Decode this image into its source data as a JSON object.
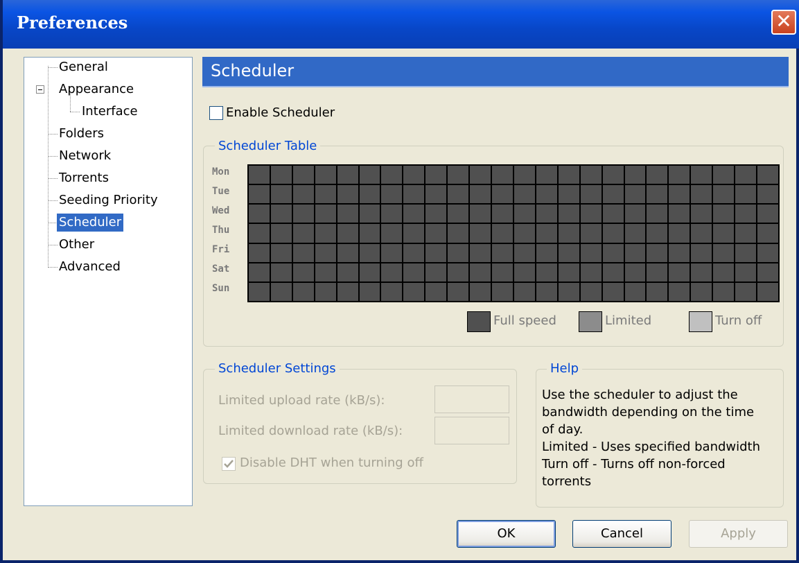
{
  "window": {
    "title": "Preferences",
    "close_glyph": "✕"
  },
  "tree": {
    "items": [
      {
        "label": "General"
      },
      {
        "label": "Appearance"
      },
      {
        "label": "Interface"
      },
      {
        "label": "Folders"
      },
      {
        "label": "Network"
      },
      {
        "label": "Torrents"
      },
      {
        "label": "Seeding Priority"
      },
      {
        "label": "Scheduler",
        "selected": true
      },
      {
        "label": "Other"
      },
      {
        "label": "Advanced"
      }
    ]
  },
  "page": {
    "title": "Scheduler"
  },
  "enable_scheduler": {
    "label": "Enable Scheduler",
    "checked": false
  },
  "scheduler_table": {
    "title": "Scheduler Table",
    "days": [
      "Mon",
      "Tue",
      "Wed",
      "Thu",
      "Fri",
      "Sat",
      "Sun"
    ],
    "hours_per_day": 24,
    "legend": [
      {
        "label": "Full speed",
        "color": "#505050"
      },
      {
        "label": "Limited",
        "color": "#8c8c8c"
      },
      {
        "label": "Turn off",
        "color": "#c0c0c0"
      }
    ]
  },
  "scheduler_settings": {
    "title": "Scheduler Settings",
    "upload_label": "Limited upload rate (kB/s):",
    "upload_value": "",
    "download_label": "Limited download rate (kB/s):",
    "download_value": "",
    "dht_label": "Disable DHT when turning off",
    "dht_checked": true
  },
  "help": {
    "title": "Help",
    "lines": [
      "Use the scheduler to adjust the",
      "bandwidth depending on the time",
      "of day.",
      "Limited - Uses specified bandwidth",
      "Turn off - Turns off non-forced",
      "torrents"
    ]
  },
  "buttons": {
    "ok": "OK",
    "cancel": "Cancel",
    "apply": "Apply"
  }
}
